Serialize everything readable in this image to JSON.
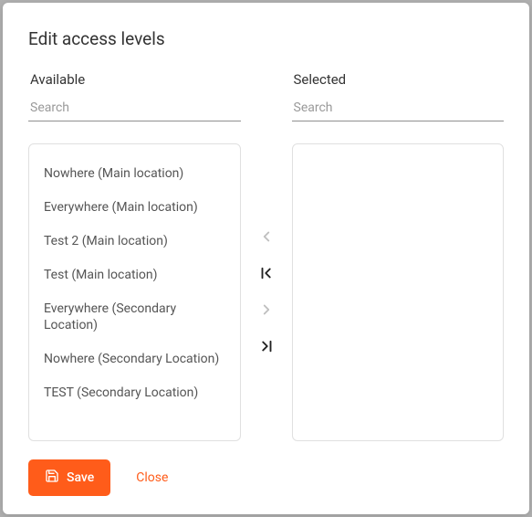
{
  "modal": {
    "title": "Edit access levels"
  },
  "available": {
    "label": "Available",
    "search_placeholder": "Search",
    "items": [
      "Nowhere (Main location)",
      "Everywhere (Main location)",
      "Test 2 (Main location)",
      "Test (Main location)",
      "Everywhere (Secondary Location)",
      "Nowhere (Secondary Location)",
      "TEST (Secondary Location)"
    ]
  },
  "selected": {
    "label": "Selected",
    "search_placeholder": "Search",
    "items": []
  },
  "footer": {
    "save_label": "Save",
    "close_label": "Close"
  },
  "colors": {
    "accent": "#ff5c1a"
  }
}
